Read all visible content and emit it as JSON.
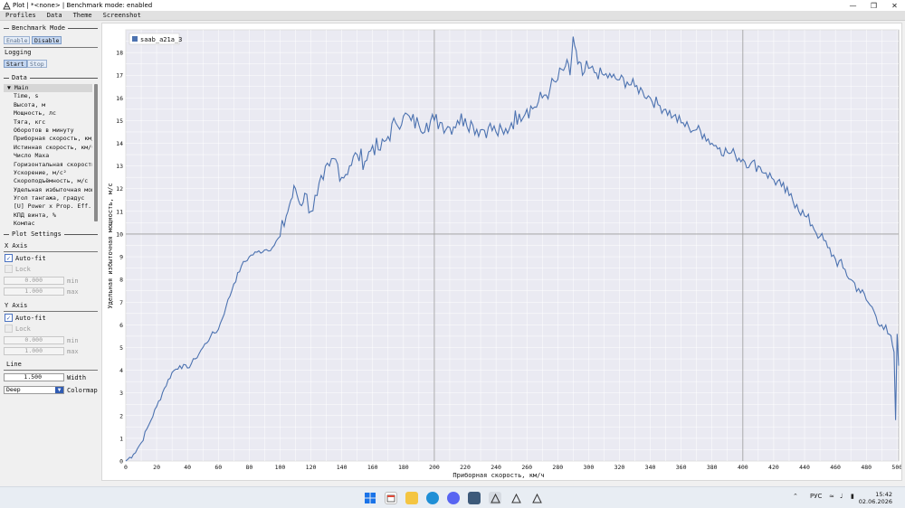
{
  "window": {
    "title": "Plot | *<none> | Benchmark mode: enabled"
  },
  "menu": [
    "Profiles",
    "Data",
    "Theme",
    "Screenshot"
  ],
  "benchmark": {
    "header": "Benchmark Mode",
    "enable": "Enable",
    "disable": "Disable"
  },
  "logging": {
    "header": "Logging",
    "start": "Start",
    "stop": "Stop"
  },
  "data_section": {
    "header": "Data",
    "group": "Main",
    "items": [
      "Time, s",
      "Высота, м",
      "Мощность, лс",
      "Тяга, кгс",
      "Оборотов в минуту",
      "Приборная скорость, км/",
      "Истинная скорость, км/ч",
      "Число Маха",
      "Горизонтальная скорость",
      "Ускорение, м/с²",
      "Скороподъёмность, м/с",
      "Удельная избыточная мощ",
      "Угол тангажа, градус",
      "[U] Power x Prop. Eff.",
      "КПД винта, %",
      "Компас"
    ]
  },
  "plot_settings": {
    "header": "Plot Settings",
    "x_axis": {
      "header": "X Axis",
      "autofit": "Auto-fit",
      "lock": "Lock",
      "min_value": "0.000",
      "min_label": "min",
      "max_value": "1.000",
      "max_label": "max"
    },
    "y_axis": {
      "header": "Y Axis",
      "autofit": "Auto-fit",
      "lock": "Lock",
      "min_value": "0.000",
      "min_label": "min",
      "max_value": "1.000",
      "max_label": "max"
    },
    "line": {
      "header": "Line",
      "width_value": "1.500",
      "width_label": "Width",
      "colormap_value": "Deep",
      "colormap_label": "Colormap"
    }
  },
  "chart_data": {
    "type": "line",
    "xlabel": "Приборная скорость, км/ч",
    "ylabel": "Удельная избыточная мощность, м/с",
    "xlim": [
      0,
      501
    ],
    "ylim": [
      0,
      19
    ],
    "xticks": [
      0,
      20,
      40,
      60,
      80,
      100,
      120,
      140,
      160,
      180,
      200,
      220,
      240,
      260,
      280,
      300,
      320,
      340,
      360,
      380,
      400,
      420,
      440,
      460,
      480,
      500
    ],
    "yticks": [
      0,
      1,
      2,
      3,
      4,
      5,
      6,
      7,
      8,
      9,
      10,
      11,
      12,
      13,
      14,
      15,
      16,
      17,
      18
    ],
    "major_grid_x": [
      200,
      400
    ],
    "major_grid_y": [
      10
    ],
    "legend_position": "top-left",
    "series": [
      {
        "name": "saab_a21a_3",
        "color": "#4c72b0",
        "x": [
          0,
          5,
          10,
          15,
          20,
          25,
          30,
          35,
          40,
          45,
          50,
          55,
          60,
          65,
          70,
          75,
          80,
          85,
          90,
          95,
          100,
          104,
          107,
          110,
          113,
          116,
          120,
          124,
          128,
          132,
          136,
          140,
          145,
          150,
          155,
          160,
          165,
          170,
          175,
          180,
          185,
          190,
          195,
          200,
          205,
          210,
          215,
          220,
          225,
          230,
          235,
          240,
          245,
          250,
          255,
          260,
          265,
          270,
          275,
          280,
          285,
          288,
          290,
          293,
          296,
          300,
          305,
          310,
          315,
          320,
          325,
          330,
          335,
          340,
          345,
          350,
          355,
          360,
          365,
          370,
          375,
          380,
          385,
          390,
          395,
          400,
          405,
          410,
          415,
          420,
          425,
          430,
          435,
          440,
          445,
          450,
          455,
          460,
          465,
          470,
          475,
          480,
          485,
          490,
          494,
          497,
          498,
          499,
          500,
          501
        ],
        "y": [
          0,
          0.3,
          0.8,
          1.6,
          2.4,
          3.2,
          3.9,
          4.2,
          4.1,
          4.5,
          5.0,
          5.5,
          5.8,
          6.8,
          7.8,
          8.6,
          9.0,
          9.2,
          9.3,
          9.4,
          9.9,
          10.8,
          11.5,
          12.0,
          11.3,
          11.8,
          11.0,
          11.7,
          12.4,
          13.0,
          13.3,
          12.5,
          13.0,
          13.5,
          13.2,
          13.9,
          13.7,
          14.3,
          14.9,
          15.2,
          15.0,
          14.8,
          14.9,
          15.0,
          14.9,
          14.7,
          15.0,
          15.1,
          14.8,
          14.6,
          14.7,
          14.5,
          14.4,
          14.9,
          15.3,
          15.5,
          15.6,
          16.0,
          16.4,
          16.8,
          17.4,
          17.0,
          18.7,
          17.5,
          17.0,
          17.3,
          17.1,
          17.0,
          16.9,
          16.8,
          16.7,
          16.5,
          16.3,
          16.0,
          15.7,
          15.5,
          15.2,
          14.9,
          14.7,
          14.6,
          14.4,
          14.0,
          13.8,
          13.6,
          13.5,
          13.3,
          13.1,
          13.0,
          12.7,
          12.4,
          12.1,
          11.7,
          11.3,
          10.8,
          10.4,
          9.9,
          9.4,
          8.9,
          8.5,
          8.0,
          7.6,
          7.1,
          6.6,
          6.0,
          5.6,
          5.1,
          4.8,
          1.8,
          5.6,
          4.2
        ]
      }
    ]
  }
}
